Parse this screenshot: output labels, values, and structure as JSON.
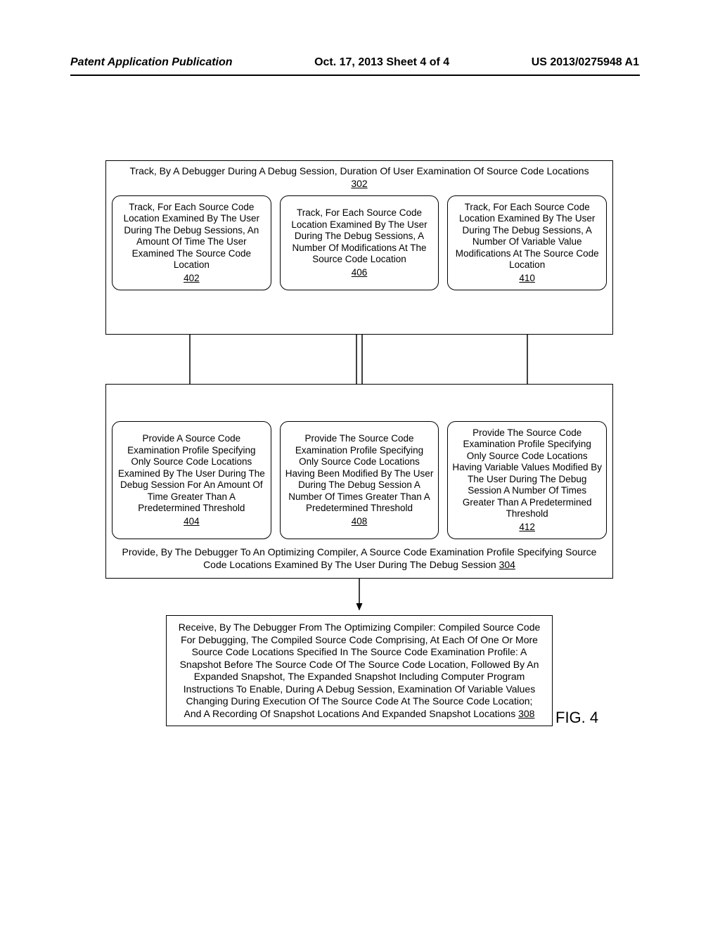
{
  "header": {
    "left": "Patent Application Publication",
    "mid": "Oct. 17, 2013  Sheet 4 of 4",
    "right": "US 2013/0275948 A1"
  },
  "box302": {
    "text": "Track, By A Debugger During A Debug Session, Duration Of User Examination Of Source Code Locations",
    "ref": "302"
  },
  "box402": {
    "text": "Track, For Each Source Code Location Examined By The User During The Debug Sessions, An Amount Of Time The User Examined The Source Code Location",
    "ref": "402"
  },
  "box406": {
    "text": "Track, For Each Source Code Location Examined By The User During The Debug Sessions, A Number Of Modifications At The Source Code Location",
    "ref": "406"
  },
  "box410": {
    "text": "Track, For Each Source Code Location Examined By The User During The Debug Sessions, A Number Of Variable Value Modifications At The Source Code Location",
    "ref": "410"
  },
  "box404": {
    "text": "Provide A Source Code Examination Profile Specifying Only Source Code Locations Examined By The User During The Debug Session For An Amount Of Time Greater Than A Predetermined Threshold",
    "ref": "404"
  },
  "box408": {
    "text": "Provide The Source Code Examination Profile Specifying Only Source Code Locations Having Been Modified By The User During The Debug Session A Number Of Times Greater Than A Predetermined Threshold",
    "ref": "408"
  },
  "box412": {
    "text": "Provide The Source Code Examination Profile Specifying Only Source Code Locations Having Variable Values Modified By The User During The Debug Session A Number Of Times Greater Than A Predetermined Threshold",
    "ref": "412"
  },
  "box304": {
    "text": "Provide, By The Debugger To An Optimizing Compiler, A Source Code Examination Profile Specifying Source Code Locations Examined By The User During The Debug Session",
    "ref": "304"
  },
  "box308": {
    "text": "Receive, By The Debugger From The Optimizing Compiler: Compiled Source Code For Debugging, The Compiled Source Code Comprising, At Each Of One Or More Source Code Locations Specified In The Source Code Examination Profile: A Snapshot Before The Source Code Of The Source Code Location, Followed By An Expanded Snapshot, The Expanded Snapshot Including Computer Program Instructions To Enable, During A Debug Session, Examination Of Variable Values Changing During Execution Of The Source Code At The Source Code Location; And A Recording Of Snapshot Locations And Expanded Snapshot Locations",
    "ref": "308"
  },
  "figLabel": "FIG. 4"
}
